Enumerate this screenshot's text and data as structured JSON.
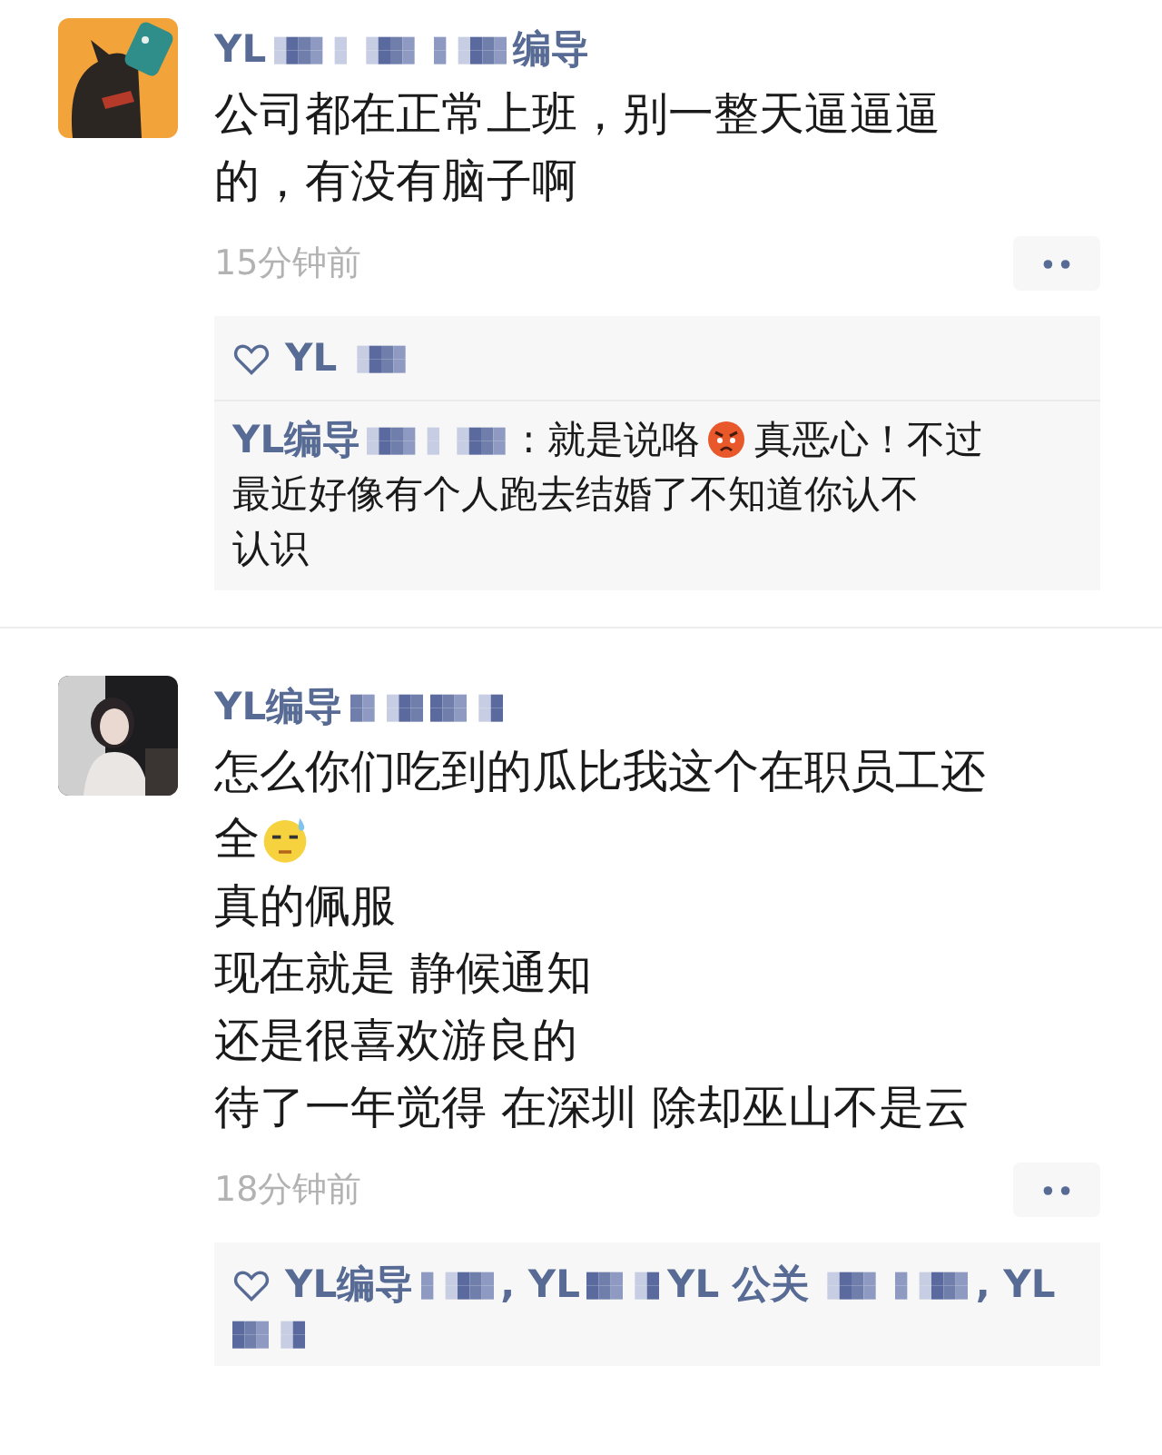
{
  "posts": [
    {
      "avatar": {
        "kind": "picture"
      },
      "name": [
        {
          "kind": "text",
          "text": "YL"
        },
        {
          "kind": "mosaic"
        },
        {
          "kind": "mosaic"
        },
        {
          "kind": "mosaic"
        },
        {
          "kind": "text",
          "text": "编导"
        }
      ],
      "lines": [
        [
          {
            "kind": "text",
            "text": "公司都在正常上班，别一整天逼逼逼"
          }
        ],
        [
          {
            "kind": "text",
            "text": "的，有没有脑子啊"
          }
        ]
      ],
      "time": "15分钟前",
      "likes": [
        {
          "kind": "text",
          "text": "YL"
        },
        {
          "kind": "mosaic"
        }
      ],
      "comments": [
        {
          "lines": [
            [
              {
                "kind": "name",
                "text": "YL编导"
              },
              {
                "kind": "mosaic"
              },
              {
                "kind": "mosaic"
              },
              {
                "kind": "text",
                "text": ": 就是说咯"
              },
              {
                "kind": "angry_emoji"
              },
              {
                "kind": "text",
                "text": "真恶心！不过"
              }
            ],
            [
              {
                "kind": "text",
                "text": "最近好像有个人跑去结婚了不知道你认不"
              }
            ],
            [
              {
                "kind": "text",
                "text": "认识"
              }
            ]
          ]
        }
      ]
    },
    {
      "avatar": {
        "kind": "picture"
      },
      "name": [
        {
          "kind": "text",
          "text": "YL编导"
        },
        {
          "kind": "mosaic"
        },
        {
          "kind": "mosaic"
        }
      ],
      "lines": [
        [
          {
            "kind": "text",
            "text": "怎么你们吃到的瓜比我这个在职员工还"
          }
        ],
        [
          {
            "kind": "text",
            "text": "全"
          },
          {
            "kind": "sweat_emoji"
          }
        ],
        [
          {
            "kind": "text",
            "text": "真的佩服"
          }
        ],
        [
          {
            "kind": "text",
            "text": "现在就是 静候通知"
          }
        ],
        [
          {
            "kind": "text",
            "text": "还是很喜欢游良的"
          }
        ],
        [
          {
            "kind": "text",
            "text": "待了一年觉得 在深圳 除却巫山不是云"
          }
        ]
      ],
      "time": "18分钟前",
      "likes": [
        {
          "kind": "text",
          "text": "YL编导"
        },
        {
          "kind": "mosaic"
        },
        {
          "kind": "text",
          "text": ", YL"
        },
        {
          "kind": "mosaic"
        },
        {
          "kind": "text",
          "text": " YL 公关"
        },
        {
          "kind": "mosaic"
        },
        {
          "kind": "mosaic"
        },
        {
          "kind": "text",
          "text": ", YL"
        },
        {
          "kind": "mosaic"
        }
      ]
    }
  ]
}
